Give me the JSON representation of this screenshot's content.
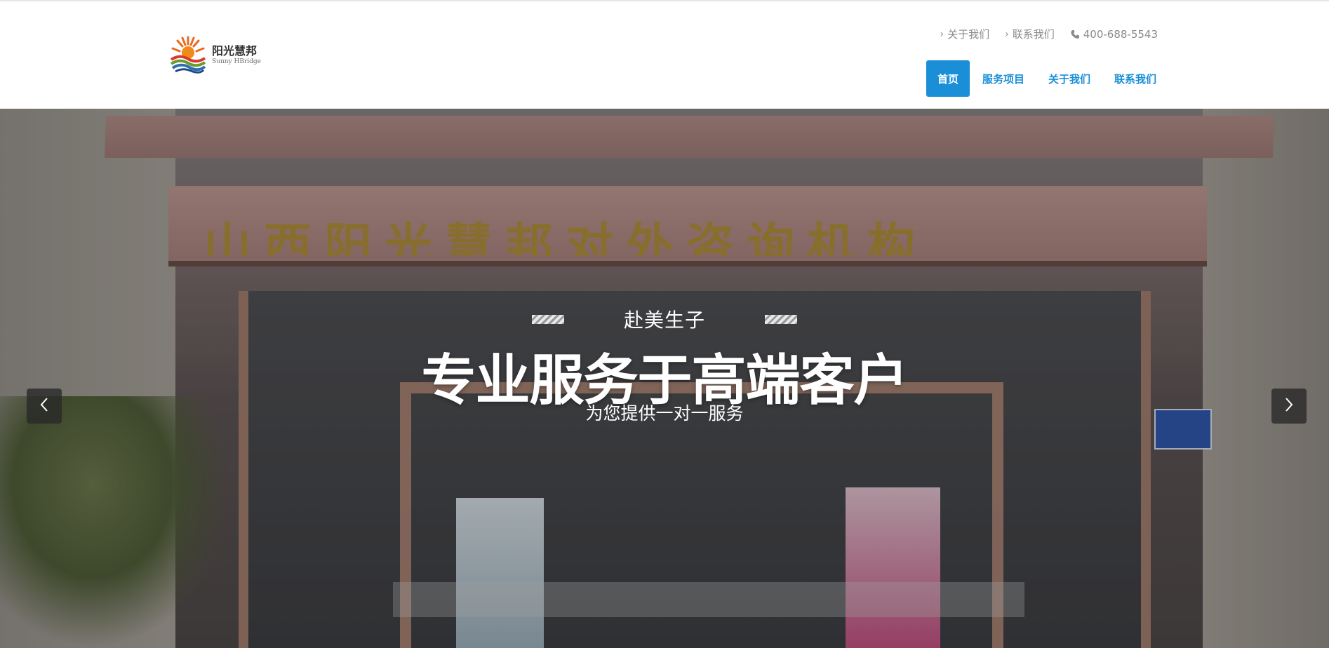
{
  "brand": {
    "name_cn": "阳光慧邦",
    "name_en": "Sunny HBridge"
  },
  "top_links": {
    "about": "关于我们",
    "contact": "联系我们",
    "phone": "400-688-5543"
  },
  "nav": {
    "items": [
      {
        "label": "首页",
        "active": true
      },
      {
        "label": "服务项目",
        "active": false
      },
      {
        "label": "关于我们",
        "active": false
      },
      {
        "label": "联系我们",
        "active": false
      }
    ]
  },
  "hero": {
    "sign_text": "山西阳光慧邦对外咨询机构",
    "kicker": "赴美生子",
    "headline": "专业服务于高端客户",
    "subline": "为您提供一对一服务"
  },
  "colors": {
    "accent": "#1a8fd8",
    "link_gray": "#8a8a8a"
  },
  "icons": {
    "prev": "chevron-left-icon",
    "next": "chevron-right-icon",
    "phone": "phone-icon",
    "link": "chevron-right-small-icon"
  }
}
